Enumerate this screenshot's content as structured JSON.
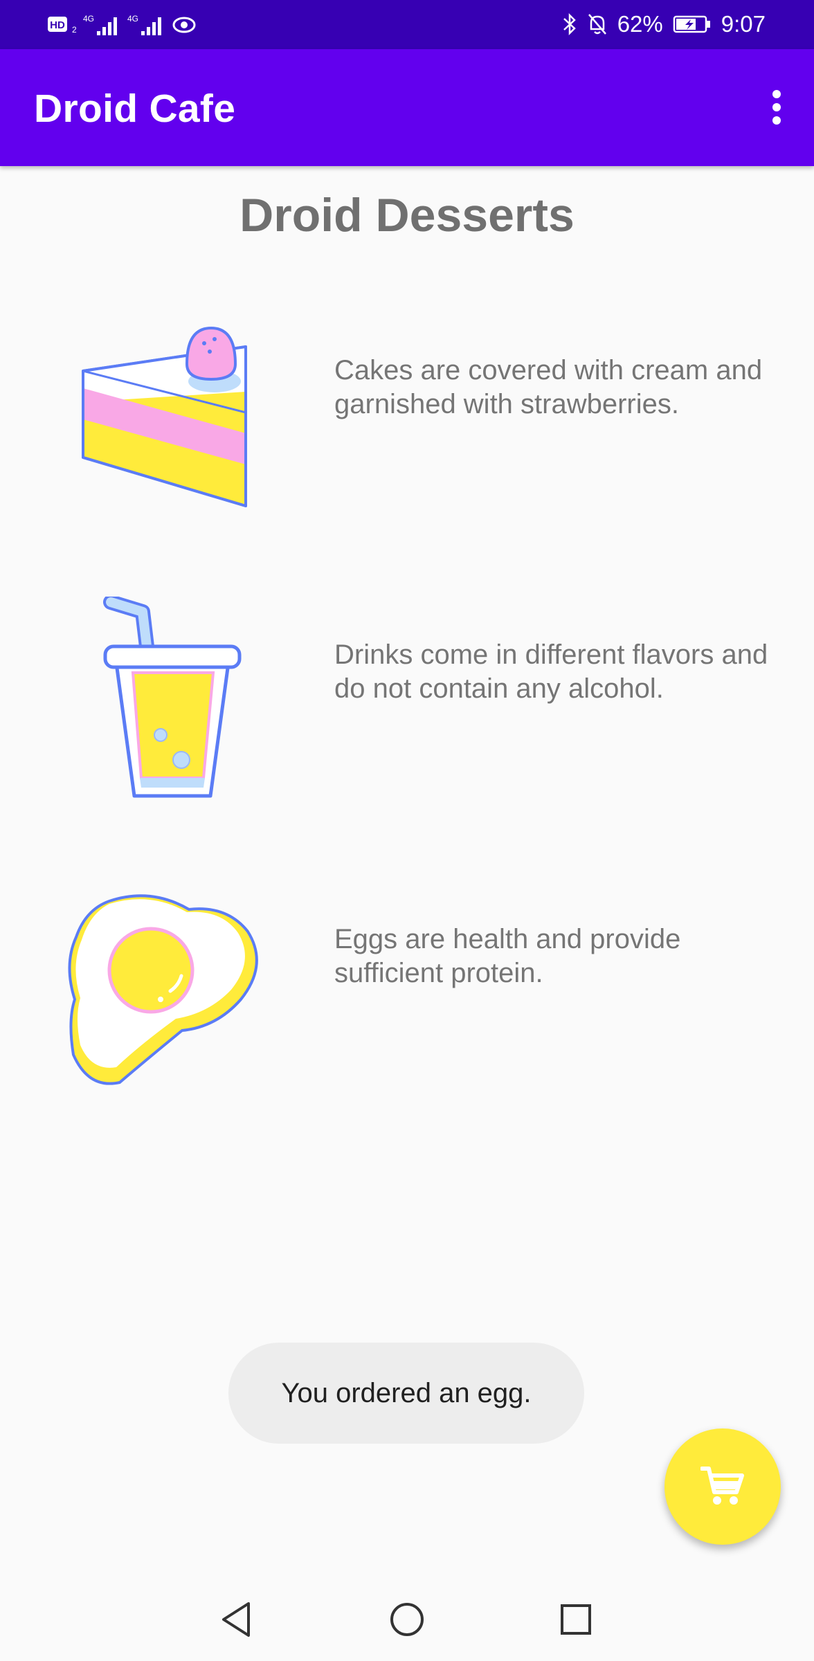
{
  "status_bar": {
    "left_badge": "HD",
    "network_label_1": "4G",
    "network_label_2": "4G",
    "battery": "62%",
    "time": "9:07"
  },
  "app_bar": {
    "title": "Droid Cafe",
    "overflow_icon": "more-vert-icon",
    "background": "#6200EE"
  },
  "page": {
    "title": "Droid Desserts"
  },
  "desserts": [
    {
      "name": "cake",
      "icon": "cake-icon",
      "description": "Cakes are covered with cream and garnished with strawberries."
    },
    {
      "name": "drink",
      "icon": "drink-icon",
      "description": "Drinks come in different flavors and do not contain any alcohol."
    },
    {
      "name": "egg",
      "icon": "egg-icon",
      "description": "Eggs are health and provide sufficient protein."
    }
  ],
  "toast": {
    "message": "You ordered an egg."
  },
  "fab": {
    "icon": "shopping-cart-icon",
    "color": "#FFEB3B"
  },
  "nav": {
    "back_icon": "back-triangle-icon",
    "home_icon": "home-circle-icon",
    "recents_icon": "recents-square-icon"
  }
}
